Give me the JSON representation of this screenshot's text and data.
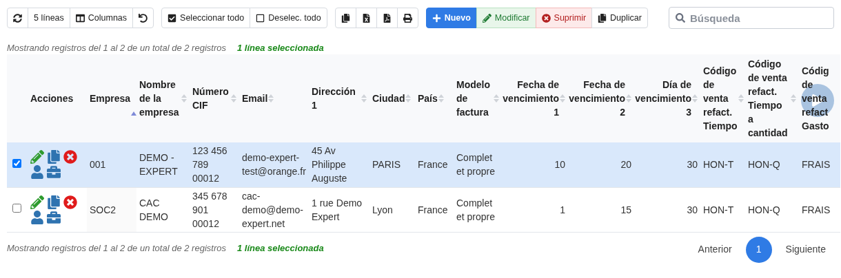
{
  "toolbar": {
    "groups": [
      {
        "buttons": [
          {
            "kind": "icon"
          },
          {
            "label": "5 líneas",
            "kind": "default"
          },
          {
            "label": "Columnas",
            "kind": "default"
          },
          {
            "kind": "icon"
          }
        ]
      },
      {
        "buttons": [
          {
            "label": "Seleccionar todo",
            "kind": "default"
          },
          {
            "label": "Deselec. todo",
            "kind": "default"
          }
        ]
      },
      {
        "buttons": [
          {
            "kind": "icon"
          },
          {
            "kind": "icon"
          },
          {
            "kind": "icon"
          },
          {
            "kind": "icon"
          }
        ]
      },
      {
        "buttons": [
          {
            "label": "Nuevo",
            "kind": "primary"
          },
          {
            "label": "Modificar",
            "kind": "success"
          },
          {
            "label": "Suprimir",
            "kind": "danger"
          },
          {
            "label": "Duplicar",
            "kind": "default"
          }
        ]
      }
    ],
    "search": {
      "placeholder": "Búsqueda"
    }
  },
  "info_top": {
    "text": "Mostrando registros del 1 al 2 de un total de 2 registros",
    "selection": "1 línea seleccionada"
  },
  "table": {
    "columns": [
      {
        "label": "Acciones",
        "kind": "actions"
      },
      {
        "label": "Empresa",
        "sorted": true,
        "kind": "text"
      },
      {
        "label": "Nombre de la empresa",
        "sorted": false,
        "kind": "text"
      },
      {
        "label": "Número CIF",
        "sorted": false,
        "kind": "text"
      },
      {
        "label": "Email",
        "sorted": false,
        "kind": "text"
      },
      {
        "label": "Dirección 1",
        "sorted": false,
        "kind": "text"
      },
      {
        "label": "Ciudad",
        "sorted": false,
        "kind": "text"
      },
      {
        "label": "País",
        "sorted": false,
        "kind": "text"
      },
      {
        "label": "Modelo de factura",
        "sorted": false,
        "kind": "text"
      },
      {
        "label": "Fecha de vencimiento 1",
        "sorted": false,
        "kind": "number"
      },
      {
        "label": "Fecha de vencimiento 2",
        "sorted": false,
        "kind": "number"
      },
      {
        "label": "Día de vencimiento 3",
        "sorted": false,
        "kind": "number"
      },
      {
        "label": "Código de venta refact. Tiempo",
        "sorted": false,
        "kind": "text"
      },
      {
        "label": "Código de venta refact. Tiempo a cantidad",
        "sorted": false,
        "kind": "text"
      },
      {
        "label": "Códig de venta refact Gasto",
        "kind": "text"
      }
    ],
    "rows": [
      {
        "selected": true,
        "checked": true,
        "cells": [
          "",
          "001",
          "DEMO - EXPERT",
          "123 456 789 00012",
          "demo-expert-test@orange.fr",
          "45 Av Philippe Auguste",
          "PARIS",
          "France",
          "Complet et propre",
          "10",
          "20",
          "30",
          "HON-T",
          "HON-Q",
          "FRAIS"
        ]
      },
      {
        "selected": false,
        "checked": false,
        "cells": [
          "",
          "SOC2",
          "CAC DEMO",
          "345 678 901 00012",
          "cac-demo@demo-expert.net",
          "1 rue Demo Expert",
          "Lyon",
          "France",
          "Complet et propre",
          "1",
          "15",
          "30",
          "HON-T",
          "HON-Q",
          "FRAIS"
        ]
      }
    ]
  },
  "info_bottom": {
    "text": "Mostrando registros del 1 al 2 de un total de 2 registros",
    "selection": "1 línea seleccionada"
  },
  "pagination": {
    "previous": "Anterior",
    "pages": [
      {
        "label": "1",
        "selected": true
      }
    ],
    "next": "Siguiente"
  }
}
